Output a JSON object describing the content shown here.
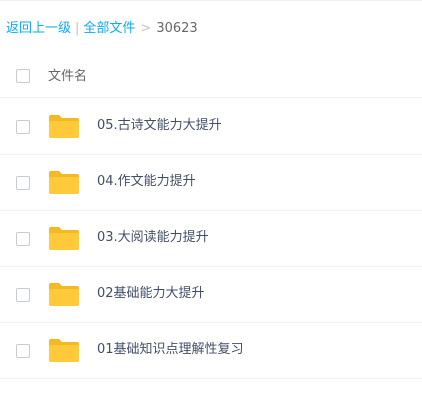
{
  "breadcrumb": {
    "back_label": "返回上一级",
    "separator": "|",
    "all_files_label": "全部文件",
    "arrow": ">",
    "current": "30623"
  },
  "header": {
    "column_label": "文件名"
  },
  "files": [
    {
      "name": "05.古诗文能力大提升",
      "icon": "folder-icon"
    },
    {
      "name": "04.作文能力提升",
      "icon": "folder-icon"
    },
    {
      "name": "03.大阅读能力提升",
      "icon": "folder-icon"
    },
    {
      "name": "02基础能力大提升",
      "icon": "folder-icon"
    },
    {
      "name": "01基础知识点理解性复习",
      "icon": "folder-icon"
    }
  ],
  "colors": {
    "link": "#09aaff",
    "folder": "#ffc93c",
    "folder_tab": "#f5b921",
    "text": "#424e67"
  }
}
